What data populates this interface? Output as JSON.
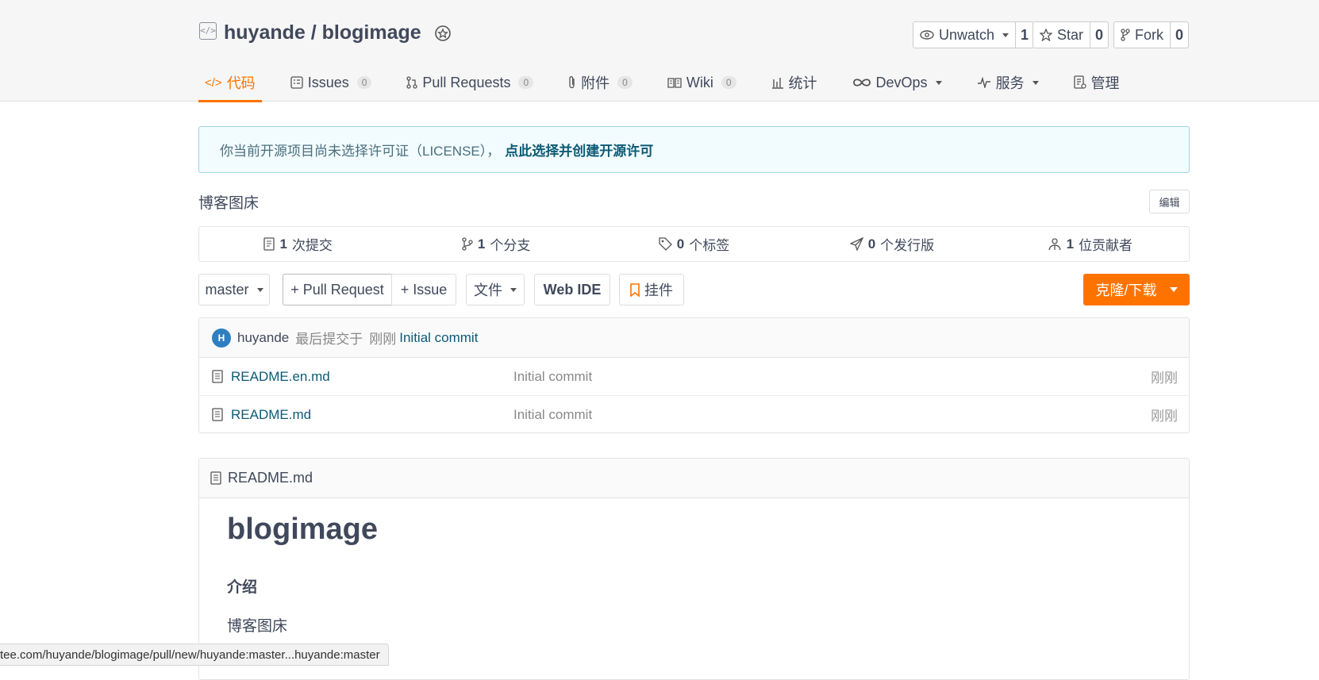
{
  "repo": {
    "owner": "huyande",
    "separator": " / ",
    "name": "blogimage"
  },
  "counters": {
    "watch_label": "Unwatch",
    "watch_count": "1",
    "star_label": "Star",
    "star_count": "0",
    "fork_label": "Fork",
    "fork_count": "0"
  },
  "tabs": [
    {
      "label": "代码",
      "count": "",
      "icon": "code-icon"
    },
    {
      "label": "Issues",
      "count": "0",
      "icon": "issues-icon"
    },
    {
      "label": "Pull Requests",
      "count": "0",
      "icon": "pull-request-icon"
    },
    {
      "label": "附件",
      "count": "0",
      "icon": "paperclip-icon"
    },
    {
      "label": "Wiki",
      "count": "0",
      "icon": "book-icon"
    },
    {
      "label": "统计",
      "count": "",
      "icon": "bar-chart-icon"
    },
    {
      "label": "DevOps",
      "count": "",
      "icon": "infinity-icon"
    },
    {
      "label": "服务",
      "count": "",
      "icon": "pulse-icon"
    },
    {
      "label": "管理",
      "count": "",
      "icon": "settings-doc-icon"
    }
  ],
  "notice": {
    "text": "你当前开源项目尚未选择许可证（LICENSE），",
    "link": "点此选择并创建开源许可"
  },
  "description": "博客图床",
  "edit_label": "编辑",
  "stats": [
    {
      "num": "1",
      "label": "次提交"
    },
    {
      "num": "1",
      "label": "个分支"
    },
    {
      "num": "0",
      "label": "个标签"
    },
    {
      "num": "0",
      "label": "个发行版"
    },
    {
      "num": "1",
      "label": "位贡献者"
    }
  ],
  "toolbar": {
    "branch": "master",
    "pull_request": "+ Pull Request",
    "issue": "+ Issue",
    "file": "文件",
    "web_ide": "Web IDE",
    "widget": "挂件",
    "clone": "克隆/下载"
  },
  "last_commit": {
    "avatar": "H",
    "author": "huyande",
    "text": "最后提交于",
    "time": "刚刚",
    "message": "Initial commit"
  },
  "files": [
    {
      "name": "README.en.md",
      "message": "Initial commit",
      "time": "刚刚"
    },
    {
      "name": "README.md",
      "message": "Initial commit",
      "time": "刚刚"
    }
  ],
  "readme": {
    "filename": "README.md",
    "h1": "blogimage",
    "h3": "介绍",
    "paragraph": "博客图床"
  },
  "status_url": "tee.com/huyande/blogimage/pull/new/huyande:master...huyande:master",
  "colors": {
    "accent": "#fe7300",
    "link": "#0d5a75",
    "avatar": "#2f7fc0"
  }
}
